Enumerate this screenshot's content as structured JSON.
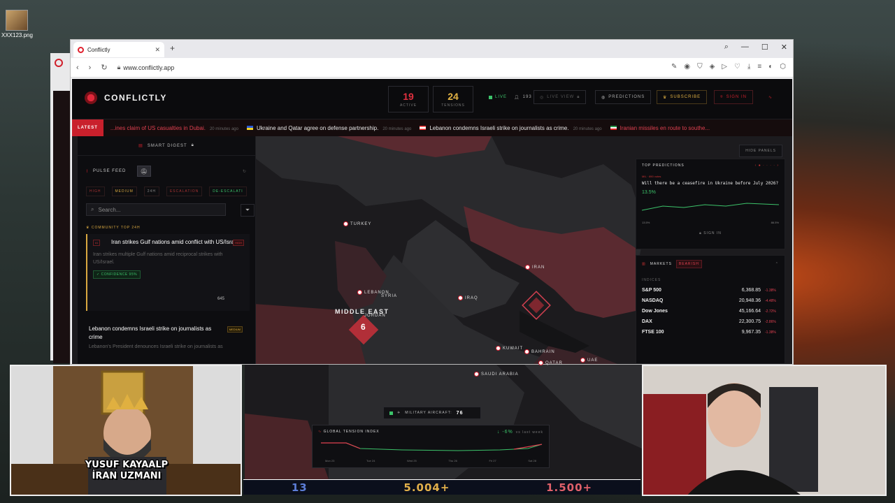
{
  "desktop": {
    "icon_label": "XXX123.png"
  },
  "browser": {
    "tab_title": "Conflictly",
    "url": "www.conflictly.app"
  },
  "app": {
    "brand": "CONFLICTLY",
    "stats": [
      {
        "value": "19",
        "caption": "ACTIVE",
        "color": "#e0303f"
      },
      {
        "value": "24",
        "caption": "TENSIONS",
        "color": "#e3b344"
      }
    ],
    "live_label": "LIVE",
    "viewers": "193",
    "live_view_label": "LIVE VIEW",
    "predictions_label": "PREDICTIONS",
    "subscribe_label": "SUBSCRIBE",
    "sign_in_label": "SIGN IN",
    "latest_label": "LATEST",
    "ticker": [
      {
        "text": "...ines claim of US casualties in Dubai.",
        "ago": "20 minutes ago",
        "red": true
      },
      {
        "text": "Ukraine and Qatar agree on defense partnership.",
        "ago": "20 minutes ago",
        "red": false
      },
      {
        "text": "Lebanon condemns Israeli strike on journalists as crime.",
        "ago": "20 minutes ago",
        "red": false
      },
      {
        "text": "Iranian missiles en route to southe...",
        "ago": "",
        "red": true
      }
    ]
  },
  "left_panel": {
    "smart_digest": "SMART DIGEST",
    "pulse_feed": "PULSE FEED",
    "filters": [
      "HIGH",
      "MEDIUM",
      "24H",
      "ESCALATION",
      "DE-ESCALATI"
    ],
    "search_placeholder": "Search...",
    "community_label": "COMMUNITY TOP 24H",
    "card1": {
      "badge": "#1",
      "title": "Iran strikes Gulf nations amid conflict with US/Israel",
      "severity": "HIGH",
      "desc": "Iran strikes multiple Gulf nations amid reciprocal strikes with US/Israel.",
      "confidence": "CONFIDENCE 95%",
      "votes": "645"
    },
    "card2": {
      "title": "Lebanon condemns Israeli strike on journalists as crime",
      "severity": "MEDIUM",
      "desc": "Lebanon's President denounces Israeli strike on journalists as"
    }
  },
  "map": {
    "region": "MIDDLE EAST",
    "cluster_count": "6",
    "hide_panels": "HIDE PANELS",
    "labels": [
      "TURKEY",
      "IRAN",
      "IRAQ",
      "LEBANON",
      "SYRIA",
      "JORDAN",
      "KUWAIT",
      "BAHRAIN",
      "QATAR",
      "UAE",
      "SAUDI ARABIA"
    ]
  },
  "predictions": {
    "title": "TOP PREDICTIONS",
    "meta": "MIL · 890 votes",
    "question": "Will there be a ceasefire in Ukraine before July 2026?",
    "pct": "13.5%",
    "range_low": "13.5%",
    "range_high": "86.5%",
    "sign_in": "SIGN IN"
  },
  "markets": {
    "title": "MARKETS",
    "sentiment": "BEARISH",
    "subtitle": "INDICES",
    "rows": [
      {
        "name": "S&P 500",
        "value": "6,368.85",
        "change": "-1.38%"
      },
      {
        "name": "NASDAQ",
        "value": "20,948.36",
        "change": "-4.48%"
      },
      {
        "name": "Dow Jones",
        "value": "45,166.64",
        "change": "-2.72%"
      },
      {
        "name": "DAX",
        "value": "22,300.75",
        "change": "-2.86%"
      },
      {
        "name": "FTSE 100",
        "value": "9,967.35",
        "change": "-1.38%"
      }
    ]
  },
  "military": {
    "label": "MILITARY AIRCRAFT:",
    "count": "76"
  },
  "tension": {
    "title": "GLOBAL TENSION INDEX",
    "delta": "-6%",
    "delta_note": "vs last week",
    "days": [
      "Mon 23",
      "Tue 24",
      "Wed 25",
      "Thu 26",
      "Fri 27",
      "Sat 28"
    ]
  },
  "stream": {
    "name_line1": "YUSUF KAYAALP",
    "name_line2": "İRAN UZMANI",
    "bottom_values": [
      "13",
      "5.004+",
      "1.500+"
    ]
  }
}
